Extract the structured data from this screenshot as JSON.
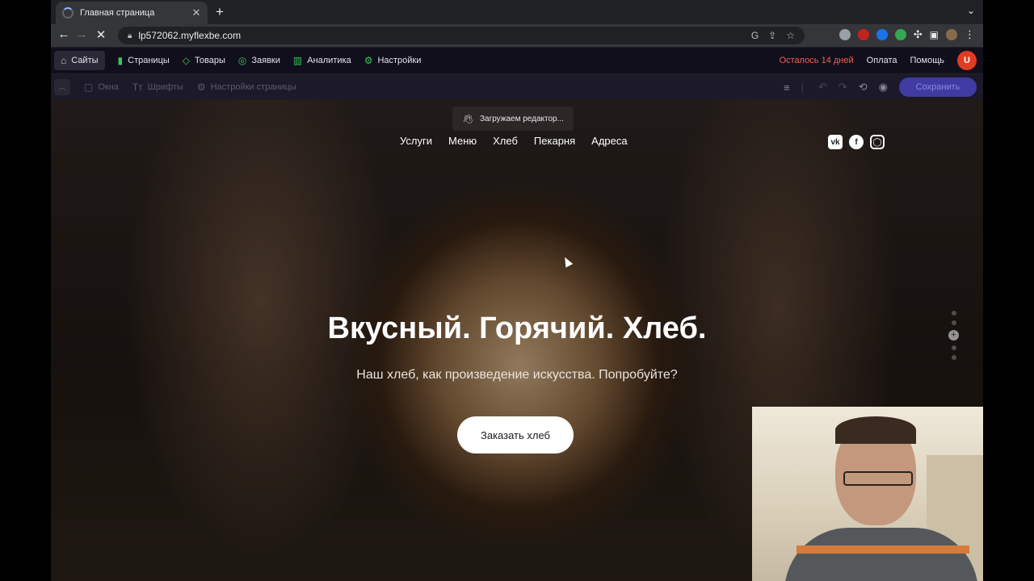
{
  "browser": {
    "tab_title": "Главная страница",
    "url": "lp572062.myflexbe.com"
  },
  "appbar": {
    "menu": [
      {
        "label": "Сайты",
        "icon": "home-icon"
      },
      {
        "label": "Страницы",
        "icon": "pages-icon"
      },
      {
        "label": "Товары",
        "icon": "tag-icon"
      },
      {
        "label": "Заявки",
        "icon": "target-icon"
      },
      {
        "label": "Аналитика",
        "icon": "chart-icon"
      },
      {
        "label": "Настройки",
        "icon": "gear-icon"
      }
    ],
    "trial": "Осталось 14 дней",
    "payment": "Оплата",
    "help": "Помощь",
    "avatar": "U"
  },
  "toolbar": {
    "windows": "Окна",
    "fonts": "Шрифты",
    "page_settings": "Настройки страницы",
    "save": "Сохранить"
  },
  "hero": {
    "toast": "Загружаем редактор...",
    "nav": [
      "Услуги",
      "Меню",
      "Хлеб",
      "Пекарня",
      "Адреса"
    ],
    "socials": [
      "vk-icon",
      "facebook-icon",
      "instagram-icon"
    ],
    "title": "Вкусный. Горячий. Хлеб.",
    "subtitle": "Наш хлеб, как произведение искусства. Попробуйте?",
    "cta": "Заказать хлеб"
  },
  "colors": {
    "accent": "#3f3ba3",
    "trial": "#f0614d",
    "avatar": "#e23b24"
  }
}
